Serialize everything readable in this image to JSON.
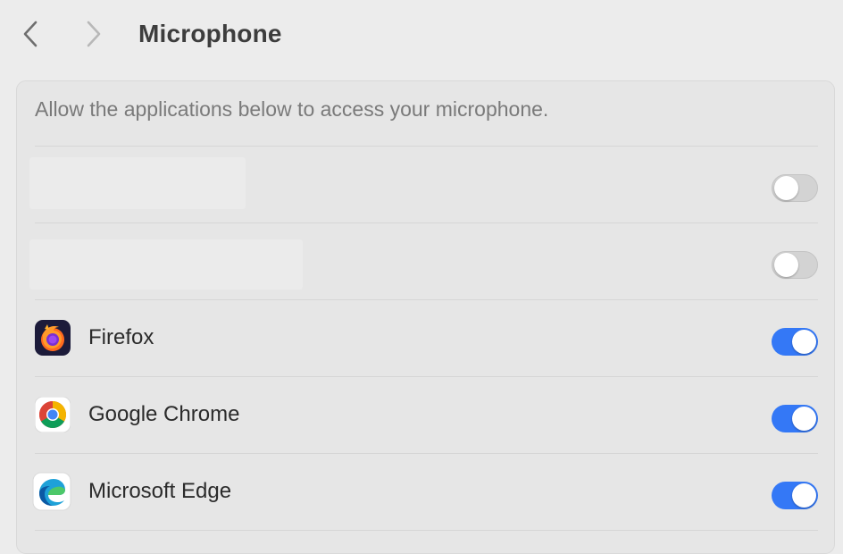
{
  "header": {
    "back_icon": "chevron-left-icon",
    "forward_icon": "chevron-right-icon",
    "title": "Microphone"
  },
  "panel": {
    "description": "Allow the applications below to access your microphone.",
    "apps": [
      {
        "name": "",
        "icon": "redacted",
        "enabled": false
      },
      {
        "name": "",
        "icon": "redacted",
        "enabled": false
      },
      {
        "name": "Firefox",
        "icon": "firefox-icon",
        "enabled": true
      },
      {
        "name": "Google Chrome",
        "icon": "chrome-icon",
        "enabled": true
      },
      {
        "name": "Microsoft Edge",
        "icon": "edge-icon",
        "enabled": true
      }
    ]
  },
  "colors": {
    "toggle_on": "#3478f6",
    "toggle_off": "#d3d3d3",
    "background": "#ececec"
  }
}
